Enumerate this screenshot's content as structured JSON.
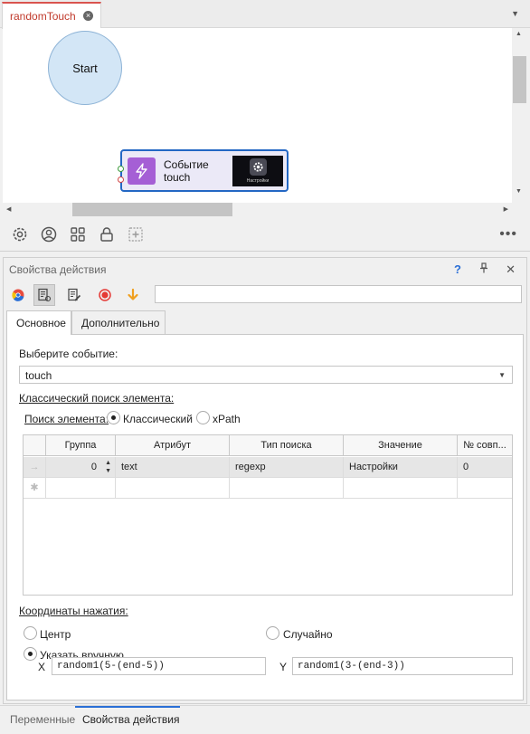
{
  "document_tab": {
    "title": "randomTouch",
    "close_glyph": "×"
  },
  "canvas": {
    "start_node": {
      "label": "Start"
    },
    "event_node": {
      "label_line1": "Событие",
      "label_line2": "touch",
      "icon": "lightning-icon",
      "thumbnail_caption": "Настройки"
    }
  },
  "canvas_toolbar": {
    "icons": [
      "settings-icon",
      "user-icon",
      "grid-icon",
      "lock-icon",
      "add-frame-icon"
    ],
    "more": "•••"
  },
  "panel": {
    "title": "Свойства действия",
    "help": "?",
    "close": "✕",
    "toolbar_icons": [
      "chrome-icon",
      "properties-icon",
      "edit-icon",
      "record-icon",
      "arrow-down-icon"
    ],
    "search_value": "",
    "tabs": [
      {
        "label": "Основное",
        "active": true
      },
      {
        "label": "Дополнительно",
        "active": false
      }
    ],
    "event_label": "Выберите событие:",
    "event_value": "touch",
    "classic_search_label": "Классический поиск элемента:",
    "search_mode": {
      "label": "Поиск элемента:",
      "options": [
        {
          "label": "Классический",
          "selected": true
        },
        {
          "label": "xPath",
          "selected": false
        }
      ]
    },
    "table": {
      "columns": [
        "Группа",
        "Атрибут",
        "Тип поиска",
        "Значение",
        "№ совп..."
      ],
      "rows": [
        {
          "marker": "→",
          "group": "0",
          "attribute": "text",
          "search_type": "regexp",
          "value": "Настройки",
          "match": "0"
        }
      ],
      "new_row_marker": "✱"
    },
    "coords_label": "Координаты нажатия:",
    "coords_options": [
      {
        "label": "Центр",
        "selected": false
      },
      {
        "label": "Случайно",
        "selected": false
      },
      {
        "label": "Указать вручную",
        "selected": true
      }
    ],
    "x_label": "X",
    "x_value": "random1(5-(end-5))",
    "y_label": "Y",
    "y_value": "random1(3-(end-3))"
  },
  "bottom_tabs": [
    {
      "label": "Переменные",
      "active": false
    },
    {
      "label": "Свойства действия",
      "active": true
    }
  ],
  "colors": {
    "accent_blue": "#2367c4",
    "tab_red": "#c0392b",
    "event_icon_purple": "#a55fd5",
    "start_fill": "#d3e6f6"
  }
}
